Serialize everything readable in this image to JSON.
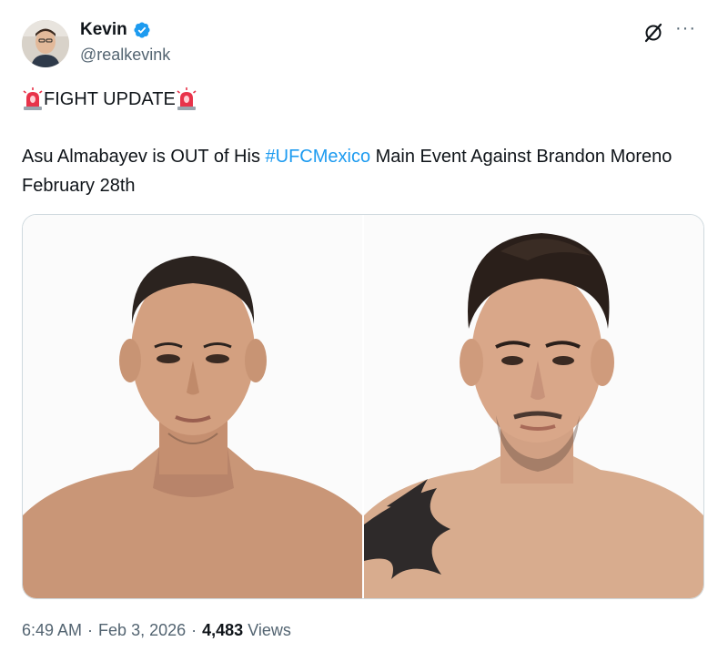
{
  "author": {
    "display_name": "Kevin",
    "handle": "@realkevink",
    "verified": true,
    "verified_color": "#1d9bf0"
  },
  "tweet": {
    "headline": "FIGHT UPDATE",
    "headline_emoji": "police-car-light",
    "text_before": "Asu Almabayev is OUT of His ",
    "hashtag": "#UFCMexico",
    "text_after": " Main Event Against Brandon Moreno February 28th",
    "hashtag_color": "#1d9bf0"
  },
  "media": {
    "images": [
      {
        "name": "fighter-photo-left"
      },
      {
        "name": "fighter-photo-right"
      }
    ]
  },
  "meta": {
    "time": "6:49 AM",
    "separator": "·",
    "date": "Feb 3, 2026",
    "views_count": "4,483",
    "views_label": "Views"
  },
  "icons": {
    "more": "more-icon",
    "grok": "grok-icon"
  }
}
